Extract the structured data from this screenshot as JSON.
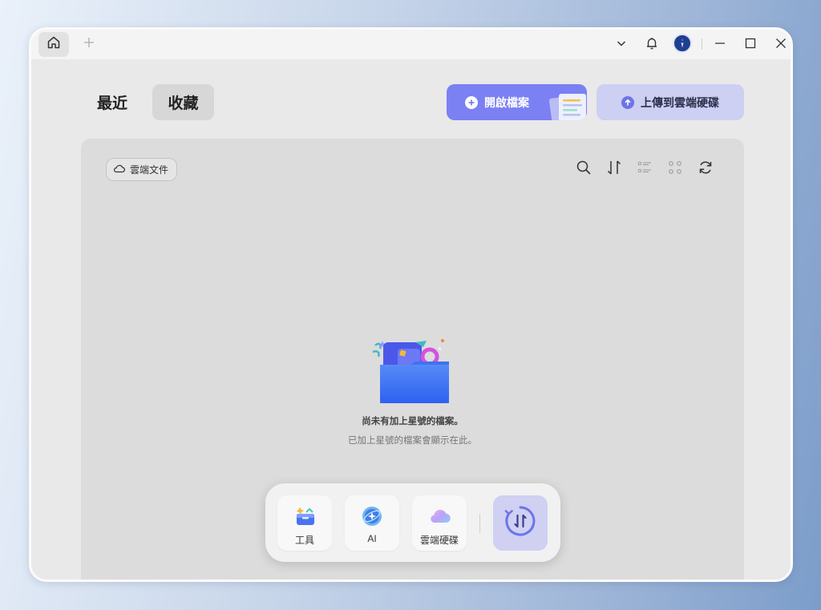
{
  "tabs": {
    "recent_label": "最近",
    "favorites_label": "收藏"
  },
  "actions": {
    "open_file_label": "開啟檔案",
    "upload_cloud_label": "上傳到雲端硬碟"
  },
  "panel": {
    "cloud_chip_label": "雲端文件",
    "empty_title": "尚未有加上星號的檔案。",
    "empty_subtitle": "已加上星號的檔案會顯示在此。"
  },
  "dock": {
    "tools_label": "工具",
    "ai_label": "AI",
    "cloud_drive_label": "雲端硬碟"
  },
  "icons": {
    "titlebar": [
      "home-icon",
      "plus-icon",
      "chevron-down-icon",
      "bell-icon",
      "avatar",
      "minimize-icon",
      "maximize-icon",
      "close-icon"
    ],
    "panel_tools": [
      "search-icon",
      "sort-icon",
      "list-view-icon",
      "grid-view-icon",
      "refresh-icon"
    ]
  },
  "colors": {
    "accent": "#7b80f2",
    "accent_light": "#cdcff3",
    "panel_bg": "#dcdcdc",
    "window_bg": "#e9e9e9"
  }
}
